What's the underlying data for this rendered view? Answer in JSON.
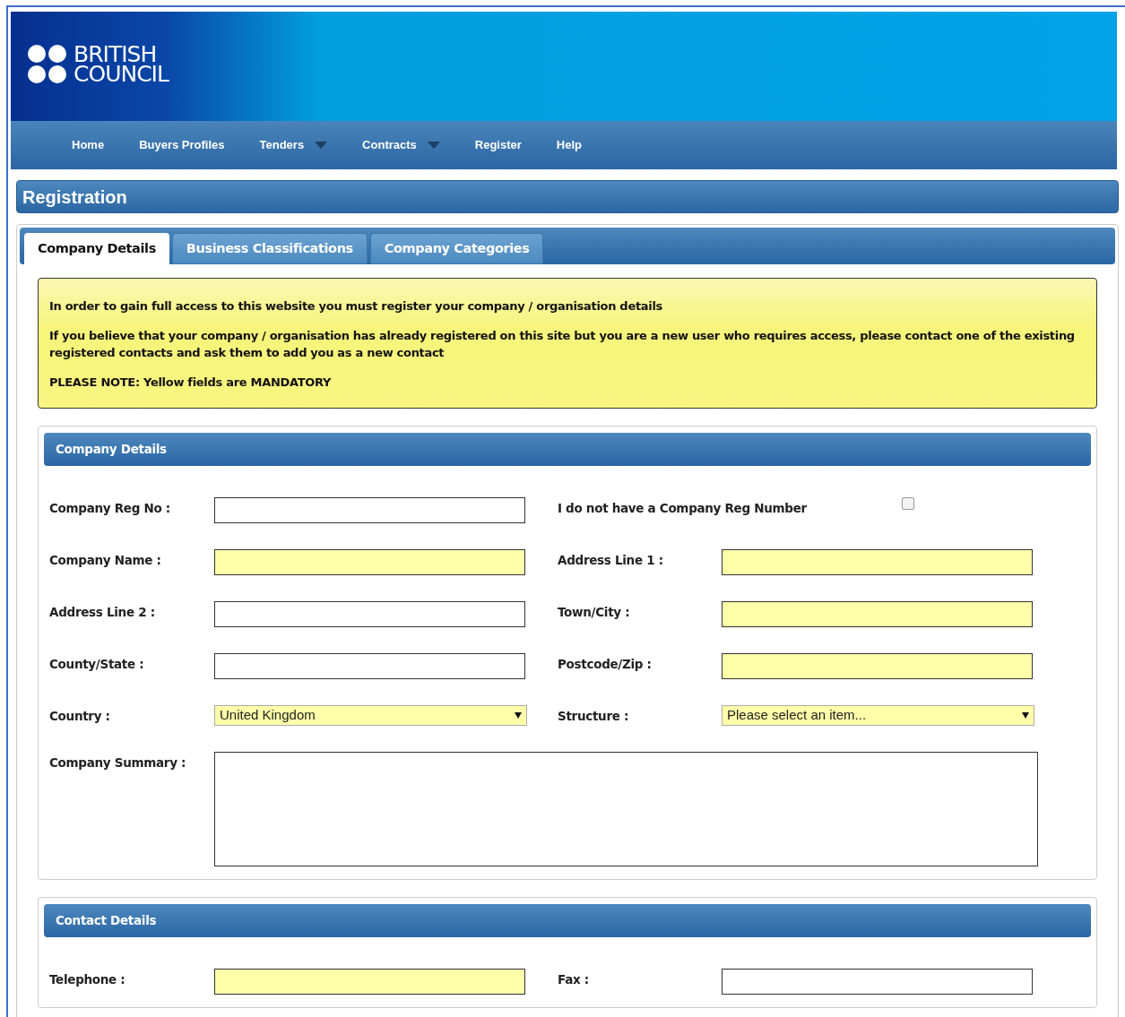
{
  "logo": {
    "line1": "BRITISH",
    "line2": "COUNCIL"
  },
  "nav": [
    {
      "label": "Home",
      "dropdown": false
    },
    {
      "label": "Buyers Profiles",
      "dropdown": false
    },
    {
      "label": "Tenders",
      "dropdown": true
    },
    {
      "label": "Contracts",
      "dropdown": true
    },
    {
      "label": "Register",
      "dropdown": false
    },
    {
      "label": "Help",
      "dropdown": false
    }
  ],
  "page_title": "Registration",
  "tabs": [
    {
      "label": "Company Details",
      "selected": true
    },
    {
      "label": "Business Classifications",
      "selected": false
    },
    {
      "label": "Company Categories",
      "selected": false
    }
  ],
  "notice": [
    "In order to gain full access to this website you must register your company / organisation details",
    "If you believe that your company / organisation has already registered on this site but you are a new user who requires access, please contact one of the existing registered contacts and ask them to add you as a new contact",
    "PLEASE NOTE: Yellow fields are MANDATORY"
  ],
  "sections": [
    {
      "title": "Company Details",
      "rows": [
        [
          {
            "kind": "text",
            "label": "Company Reg No :",
            "mandatory": false
          },
          {
            "kind": "checkbox",
            "label": "I do not have a Company Reg Number",
            "checked": false
          }
        ],
        [
          {
            "kind": "text",
            "label": "Company Name :",
            "mandatory": true
          },
          {
            "kind": "text",
            "label": "Address Line 1 :",
            "mandatory": true
          }
        ],
        [
          {
            "kind": "text",
            "label": "Address Line 2 :",
            "mandatory": false
          },
          {
            "kind": "text",
            "label": "Town/City :",
            "mandatory": true
          }
        ],
        [
          {
            "kind": "text",
            "label": "County/State :",
            "mandatory": false
          },
          {
            "kind": "text",
            "label": "Postcode/Zip :",
            "mandatory": true
          }
        ],
        [
          {
            "kind": "select",
            "label": "Country :",
            "value": "United Kingdom",
            "mandatory": true
          },
          {
            "kind": "select",
            "label": "Structure :",
            "value": "Please select an item...",
            "mandatory": true
          }
        ],
        [
          {
            "kind": "textarea",
            "label": "Company Summary :",
            "mandatory": false
          }
        ]
      ]
    },
    {
      "title": "Contact Details",
      "rows": [
        [
          {
            "kind": "text",
            "label": "Telephone :",
            "mandatory": true
          },
          {
            "kind": "text",
            "label": "Fax :",
            "mandatory": false
          }
        ]
      ]
    }
  ]
}
